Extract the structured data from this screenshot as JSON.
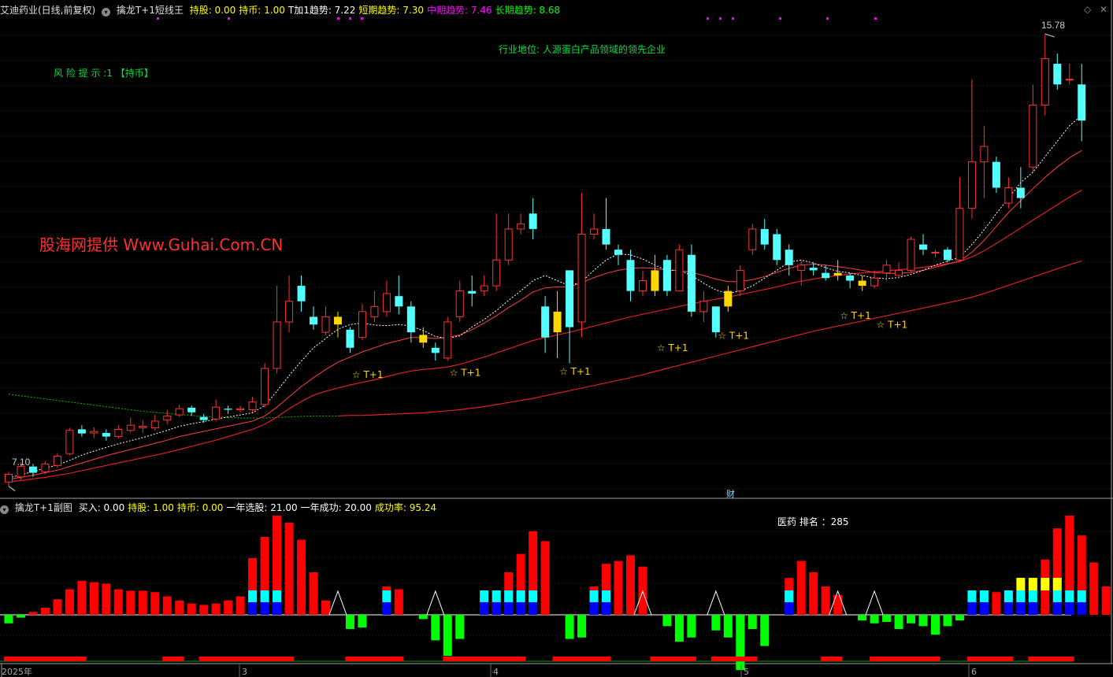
{
  "main": {
    "stock_title": "艾迪药业(日线,前复权)",
    "indicator_name": "擒龙T+1短线王",
    "stats": [
      {
        "label": "持股:",
        "value": "0.00",
        "color": "#ffff00"
      },
      {
        "label": "持币:",
        "value": "1.00",
        "color": "#ffff00"
      },
      {
        "label": "T加1趋势:",
        "value": "7.22",
        "color": "#ffffff"
      },
      {
        "label": "短期趋势:",
        "value": "7.30",
        "color": "#ffff00"
      },
      {
        "label": "中期趋势:",
        "value": "7.46",
        "color": "#ff00ff"
      },
      {
        "label": "长期趋势:",
        "value": "8.68",
        "color": "#00ff00"
      }
    ],
    "risk_text": "风 险 提 示 :1 【持币】",
    "industry_text": "行业地位: 人源蛋白产品领域的领先企业",
    "watermark": "股海网提供 Www.Guhai.Com.CN",
    "high_label": "15.78",
    "low_label": "7.10",
    "finance_marker": "财",
    "signal_label": "☆ T+1"
  },
  "sub": {
    "indicator_name": "擒龙T+1副图",
    "stats": [
      {
        "label": "买入:",
        "value": "0.00",
        "color": "#ffffff"
      },
      {
        "label": "持股:",
        "value": "1.00",
        "color": "#ffff00"
      },
      {
        "label": "持币:",
        "value": "0.00",
        "color": "#ffff00"
      },
      {
        "label": "一年选股:",
        "value": "21.00",
        "color": "#ffffff"
      },
      {
        "label": "一年成功:",
        "value": "20.00",
        "color": "#ffffff"
      },
      {
        "label": "成功率:",
        "value": "95.24",
        "color": "#ffff00"
      }
    ],
    "rank_text": "医药 排名 ：285"
  },
  "x_axis": {
    "labels": [
      "2025年",
      "3",
      "4",
      "5",
      "6"
    ]
  },
  "colors": {
    "up": "#ff3232",
    "down": "#54ffff",
    "signal": "#ffd700",
    "ma_short": "#ffffff",
    "ma_mid": "#ff3232",
    "ma_long": "#e02020",
    "bar_red": "#ff0000",
    "bar_cyan": "#00ffff",
    "bar_blue": "#0000ff",
    "bar_green": "#00ff00",
    "bar_yellow": "#ffff00"
  },
  "chart_data": {
    "type": "candlestick",
    "ylim": [
      6.8,
      16.1
    ],
    "candles": [
      [
        7.1,
        7.25,
        7.02,
        7.3
      ],
      [
        7.2,
        7.4,
        7.15,
        7.48
      ],
      [
        7.4,
        7.28,
        7.2,
        7.45
      ],
      [
        7.3,
        7.45,
        7.25,
        7.5
      ],
      [
        7.42,
        7.6,
        7.38,
        7.66
      ],
      [
        7.65,
        8.1,
        7.62,
        8.15
      ],
      [
        8.12,
        8.04,
        7.98,
        8.2
      ],
      [
        8.05,
        8.08,
        7.95,
        8.16
      ],
      [
        8.05,
        7.98,
        7.9,
        8.12
      ],
      [
        7.98,
        8.12,
        7.94,
        8.2
      ],
      [
        8.1,
        8.2,
        8.06,
        8.35
      ],
      [
        8.15,
        8.18,
        8.05,
        8.3
      ],
      [
        8.15,
        8.28,
        8.1,
        8.4
      ],
      [
        8.3,
        8.38,
        8.22,
        8.5
      ],
      [
        8.4,
        8.52,
        8.36,
        8.6
      ],
      [
        8.54,
        8.45,
        8.38,
        8.58
      ],
      [
        8.36,
        8.3,
        8.25,
        8.42
      ],
      [
        8.32,
        8.55,
        8.28,
        8.7
      ],
      [
        8.52,
        8.5,
        8.42,
        8.58
      ],
      [
        8.5,
        8.52,
        8.45,
        8.58
      ],
      [
        8.5,
        8.65,
        8.45,
        8.75
      ],
      [
        8.6,
        9.3,
        8.55,
        9.4
      ],
      [
        9.3,
        10.2,
        9.2,
        10.9
      ],
      [
        10.2,
        10.6,
        10.0,
        11.1
      ],
      [
        10.9,
        10.6,
        10.4,
        11.1
      ],
      [
        10.3,
        10.15,
        10.05,
        10.5
      ],
      [
        10.0,
        10.3,
        9.95,
        10.5
      ],
      [
        10.3,
        10.15,
        9.9,
        10.4
      ],
      [
        10.05,
        9.7,
        9.6,
        10.1
      ],
      [
        9.9,
        10.4,
        9.85,
        10.55
      ],
      [
        10.3,
        10.5,
        10.2,
        10.8
      ],
      [
        10.4,
        10.75,
        10.3,
        11.0
      ],
      [
        10.7,
        10.5,
        10.35,
        11.1
      ],
      [
        10.5,
        10.0,
        9.8,
        10.6
      ],
      [
        9.8,
        9.95,
        9.7,
        10.1
      ],
      [
        9.7,
        9.6,
        9.45,
        9.8
      ],
      [
        9.5,
        10.2,
        9.45,
        10.3
      ],
      [
        10.3,
        10.8,
        10.2,
        11.0
      ],
      [
        10.8,
        10.75,
        10.5,
        11.1
      ],
      [
        10.8,
        10.9,
        10.7,
        11.1
      ],
      [
        10.9,
        11.4,
        10.8,
        12.3
      ],
      [
        11.4,
        12.0,
        11.3,
        12.3
      ],
      [
        12.0,
        12.1,
        11.9,
        12.3
      ],
      [
        12.3,
        12.0,
        11.8,
        12.6
      ],
      [
        10.5,
        9.9,
        9.6,
        10.7
      ],
      [
        10.0,
        10.4,
        9.5,
        10.8
      ],
      [
        11.2,
        10.1,
        9.4,
        11.2
      ],
      [
        10.2,
        11.9,
        9.9,
        12.7
      ],
      [
        11.9,
        12.0,
        11.8,
        12.3
      ],
      [
        12.0,
        11.7,
        11.6,
        12.6
      ],
      [
        11.6,
        11.5,
        11.3,
        11.7
      ],
      [
        11.4,
        10.8,
        10.6,
        11.6
      ],
      [
        10.8,
        11.0,
        10.7,
        11.2
      ],
      [
        10.8,
        11.2,
        10.7,
        11.5
      ],
      [
        11.4,
        10.8,
        10.7,
        11.5
      ],
      [
        10.8,
        11.6,
        10.8,
        11.7
      ],
      [
        11.5,
        10.4,
        10.3,
        11.7
      ],
      [
        10.4,
        10.6,
        10.2,
        10.8
      ],
      [
        10.5,
        10.0,
        9.9,
        10.5
      ],
      [
        10.5,
        10.8,
        10.4,
        10.9
      ],
      [
        10.8,
        11.2,
        10.7,
        11.3
      ],
      [
        11.6,
        12.0,
        11.5,
        12.1
      ],
      [
        12.0,
        11.7,
        11.6,
        12.2
      ],
      [
        11.9,
        11.4,
        11.3,
        12.0
      ],
      [
        11.6,
        11.3,
        11.1,
        11.7
      ],
      [
        11.2,
        11.3,
        10.9,
        11.4
      ],
      [
        11.25,
        11.2,
        11.1,
        11.35
      ],
      [
        11.15,
        11.05,
        11.0,
        11.3
      ],
      [
        11.1,
        11.15,
        11.0,
        11.4
      ],
      [
        11.1,
        11.0,
        10.85,
        11.15
      ],
      [
        11.0,
        10.9,
        10.8,
        11.1
      ],
      [
        10.9,
        11.05,
        10.85,
        11.2
      ],
      [
        11.15,
        11.3,
        11.0,
        11.4
      ],
      [
        11.1,
        11.2,
        11.05,
        11.35
      ],
      [
        11.2,
        11.8,
        11.15,
        11.85
      ],
      [
        11.7,
        11.6,
        11.5,
        11.9
      ],
      [
        11.55,
        11.55,
        11.45,
        11.6
      ],
      [
        11.6,
        11.4,
        11.35,
        11.65
      ],
      [
        11.4,
        12.4,
        11.35,
        13.0
      ],
      [
        12.4,
        13.3,
        12.2,
        14.9
      ],
      [
        13.3,
        13.6,
        12.6,
        14.0
      ],
      [
        13.3,
        12.8,
        12.7,
        13.4
      ],
      [
        12.5,
        12.8,
        12.4,
        13.0
      ],
      [
        12.8,
        12.6,
        12.4,
        13.2
      ],
      [
        13.2,
        14.4,
        13.1,
        14.8
      ],
      [
        14.4,
        15.3,
        14.2,
        15.78
      ],
      [
        15.2,
        14.8,
        14.7,
        15.4
      ],
      [
        14.9,
        14.9,
        14.8,
        15.2
      ],
      [
        14.8,
        14.1,
        13.7,
        15.2
      ]
    ],
    "signal_bars": [
      27,
      34,
      45,
      53,
      59,
      68,
      70
    ],
    "t1_signals": [
      {
        "index": 29,
        "price": 9.18
      },
      {
        "index": 37,
        "price": 9.22
      },
      {
        "index": 46,
        "price": 9.24
      },
      {
        "index": 54,
        "price": 9.7
      },
      {
        "index": 59,
        "price": 9.93
      },
      {
        "index": 69,
        "price": 10.32
      },
      {
        "index": 72,
        "price": 10.15
      }
    ],
    "ma_short": [
      7.18,
      7.24,
      7.3,
      7.37,
      7.43,
      7.52,
      7.62,
      7.7,
      7.77,
      7.84,
      7.9,
      7.96,
      8.03,
      8.1,
      8.18,
      8.23,
      8.27,
      8.32,
      8.36,
      8.4,
      8.44,
      8.58,
      8.86,
      9.16,
      9.44,
      9.7,
      9.88,
      10.06,
      10.15,
      10.18,
      10.14,
      10.13,
      10.15,
      10.12,
      10.03,
      9.92,
      9.88,
      9.93,
      10.1,
      10.25,
      10.42,
      10.62,
      10.8,
      11.0,
      11.1,
      11.0,
      10.9,
      10.98,
      11.2,
      11.4,
      11.52,
      11.5,
      11.42,
      11.3,
      11.2,
      11.2,
      11.1,
      10.95,
      10.82,
      10.75,
      10.8,
      10.9,
      11.05,
      11.2,
      11.36,
      11.4,
      11.34,
      11.25,
      11.18,
      11.15,
      11.1,
      11.05,
      11.04,
      11.06,
      11.12,
      11.2,
      11.3,
      11.38,
      11.45,
      11.7,
      11.98,
      12.3,
      12.6,
      12.9,
      13.1,
      13.4,
      13.7,
      14.0,
      14.2
    ],
    "ma_mid": [
      7.15,
      7.19,
      7.23,
      7.28,
      7.33,
      7.4,
      7.47,
      7.54,
      7.61,
      7.67,
      7.73,
      7.79,
      7.85,
      7.91,
      7.98,
      8.03,
      8.08,
      8.13,
      8.18,
      8.23,
      8.28,
      8.38,
      8.55,
      8.75,
      8.95,
      9.12,
      9.28,
      9.42,
      9.52,
      9.62,
      9.7,
      9.78,
      9.84,
      9.9,
      9.9,
      9.88,
      9.9,
      9.95,
      10.05,
      10.18,
      10.32,
      10.48,
      10.62,
      10.78,
      10.86,
      10.88,
      10.88,
      10.96,
      11.06,
      11.14,
      11.2,
      11.24,
      11.25,
      11.24,
      11.2,
      11.2,
      11.16,
      11.1,
      11.03,
      10.98,
      10.98,
      11.02,
      11.08,
      11.16,
      11.24,
      11.3,
      11.32,
      11.3,
      11.27,
      11.24,
      11.2,
      11.16,
      11.14,
      11.14,
      11.16,
      11.2,
      11.26,
      11.32,
      11.38,
      11.55,
      11.78,
      12.05,
      12.32,
      12.55,
      12.78,
      13.0,
      13.2,
      13.38,
      13.52
    ],
    "ma_long": [
      7.1,
      7.13,
      7.16,
      7.19,
      7.23,
      7.27,
      7.32,
      7.37,
      7.42,
      7.47,
      7.52,
      7.57,
      7.62,
      7.67,
      7.73,
      7.79,
      7.85,
      7.91,
      7.98,
      8.05,
      8.12,
      8.22,
      8.36,
      8.52,
      8.66,
      8.78,
      8.86,
      8.92,
      8.98,
      9.03,
      9.08,
      9.14,
      9.2,
      9.25,
      9.28,
      9.3,
      9.33,
      9.38,
      9.45,
      9.52,
      9.6,
      9.68,
      9.76,
      9.84,
      9.9,
      9.95,
      10.0,
      10.06,
      10.12,
      10.18,
      10.24,
      10.3,
      10.35,
      10.4,
      10.45,
      10.5,
      10.55,
      10.6,
      10.64,
      10.68,
      10.73,
      10.78,
      10.83,
      10.88,
      10.94,
      10.99,
      11.03,
      11.07,
      11.1,
      11.13,
      11.15,
      11.17,
      11.19,
      11.21,
      11.23,
      11.26,
      11.29,
      11.33,
      11.37,
      11.46,
      11.58,
      11.72,
      11.87,
      12.02,
      12.17,
      12.32,
      12.47,
      12.62,
      12.75
    ],
    "ma_longest": [
      8.8,
      8.77,
      8.74,
      8.71,
      8.68,
      8.65,
      8.62,
      8.59,
      8.56,
      8.53,
      8.5,
      8.47,
      8.45,
      8.43,
      8.41,
      8.39,
      8.37,
      8.36,
      8.35,
      8.34,
      8.34,
      8.34,
      8.35,
      8.36,
      8.37,
      8.38,
      8.38,
      8.38,
      8.39,
      8.39,
      8.4,
      8.41,
      8.42,
      8.43,
      8.44,
      8.46,
      8.48,
      8.5,
      8.53,
      8.56,
      8.6,
      8.64,
      8.68,
      8.72,
      8.77,
      8.82,
      8.87,
      8.92,
      8.97,
      9.02,
      9.07,
      9.12,
      9.18,
      9.24,
      9.3,
      9.36,
      9.42,
      9.48,
      9.54,
      9.6,
      9.66,
      9.72,
      9.78,
      9.84,
      9.9,
      9.96,
      10.02,
      10.07,
      10.12,
      10.17,
      10.22,
      10.27,
      10.32,
      10.37,
      10.42,
      10.47,
      10.52,
      10.57,
      10.62,
      10.68,
      10.75,
      10.83,
      10.91,
      10.99,
      11.07,
      11.15,
      11.23,
      11.31,
      11.38
    ],
    "ma_longest_dashed_until": 27,
    "sub_ylim": [
      -3,
      7
    ],
    "sub_bars": [
      -0.6,
      -0.2,
      0.2,
      0.5,
      1.1,
      1.8,
      2.4,
      2.3,
      2.2,
      1.8,
      1.7,
      1.7,
      1.6,
      1.3,
      1.0,
      0.8,
      0.7,
      0.8,
      1.0,
      1.3,
      4.0,
      5.5,
      7.0,
      6.5,
      5.3,
      3.0,
      1.0,
      0,
      -1.0,
      -0.9,
      0,
      2.0,
      1.8,
      0,
      -0.3,
      -1.8,
      -2.9,
      -1.7,
      0,
      1.5,
      1.7,
      3.0,
      4.3,
      5.9,
      5.2,
      0,
      -1.7,
      -1.6,
      2.0,
      3.6,
      3.8,
      4.2,
      3.4,
      0,
      -0.8,
      -1.9,
      -1.6,
      0,
      -1.1,
      -1.6,
      -3.9,
      -1.0,
      -2.2,
      0,
      2.6,
      3.8,
      3.0,
      2.0,
      1.4,
      0,
      -0.4,
      -0.6,
      -0.5,
      -1.0,
      -0.6,
      -0.8,
      -1.4,
      -0.8,
      -0.4,
      0.2,
      1.3,
      1.6,
      1.5,
      1.2,
      0.9,
      3.9,
      6.1,
      7.0,
      5.6,
      3.7,
      2.0,
      4.2,
      4.8,
      4.4,
      1.9
    ],
    "sub_tricolor": [
      20,
      21,
      22,
      31,
      38,
      39,
      40,
      41,
      42,
      43,
      46,
      47,
      48,
      49,
      53,
      54,
      55,
      57,
      60,
      61,
      62,
      63,
      64,
      73,
      79,
      80,
      82,
      83,
      84,
      86,
      87,
      88
    ],
    "sub_yellow": [
      83,
      84,
      85,
      86
    ],
    "sub_triangles": [
      27,
      35,
      52,
      58,
      68,
      71
    ],
    "bottom_segments": [
      [
        0,
        6
      ],
      [
        13,
        14
      ],
      [
        16,
        23
      ],
      [
        28,
        32
      ],
      [
        36,
        42
      ],
      [
        45,
        49
      ],
      [
        53,
        56
      ],
      [
        58,
        61
      ],
      [
        67,
        68
      ],
      [
        71,
        76
      ],
      [
        79,
        82
      ],
      [
        84,
        87
      ]
    ]
  }
}
